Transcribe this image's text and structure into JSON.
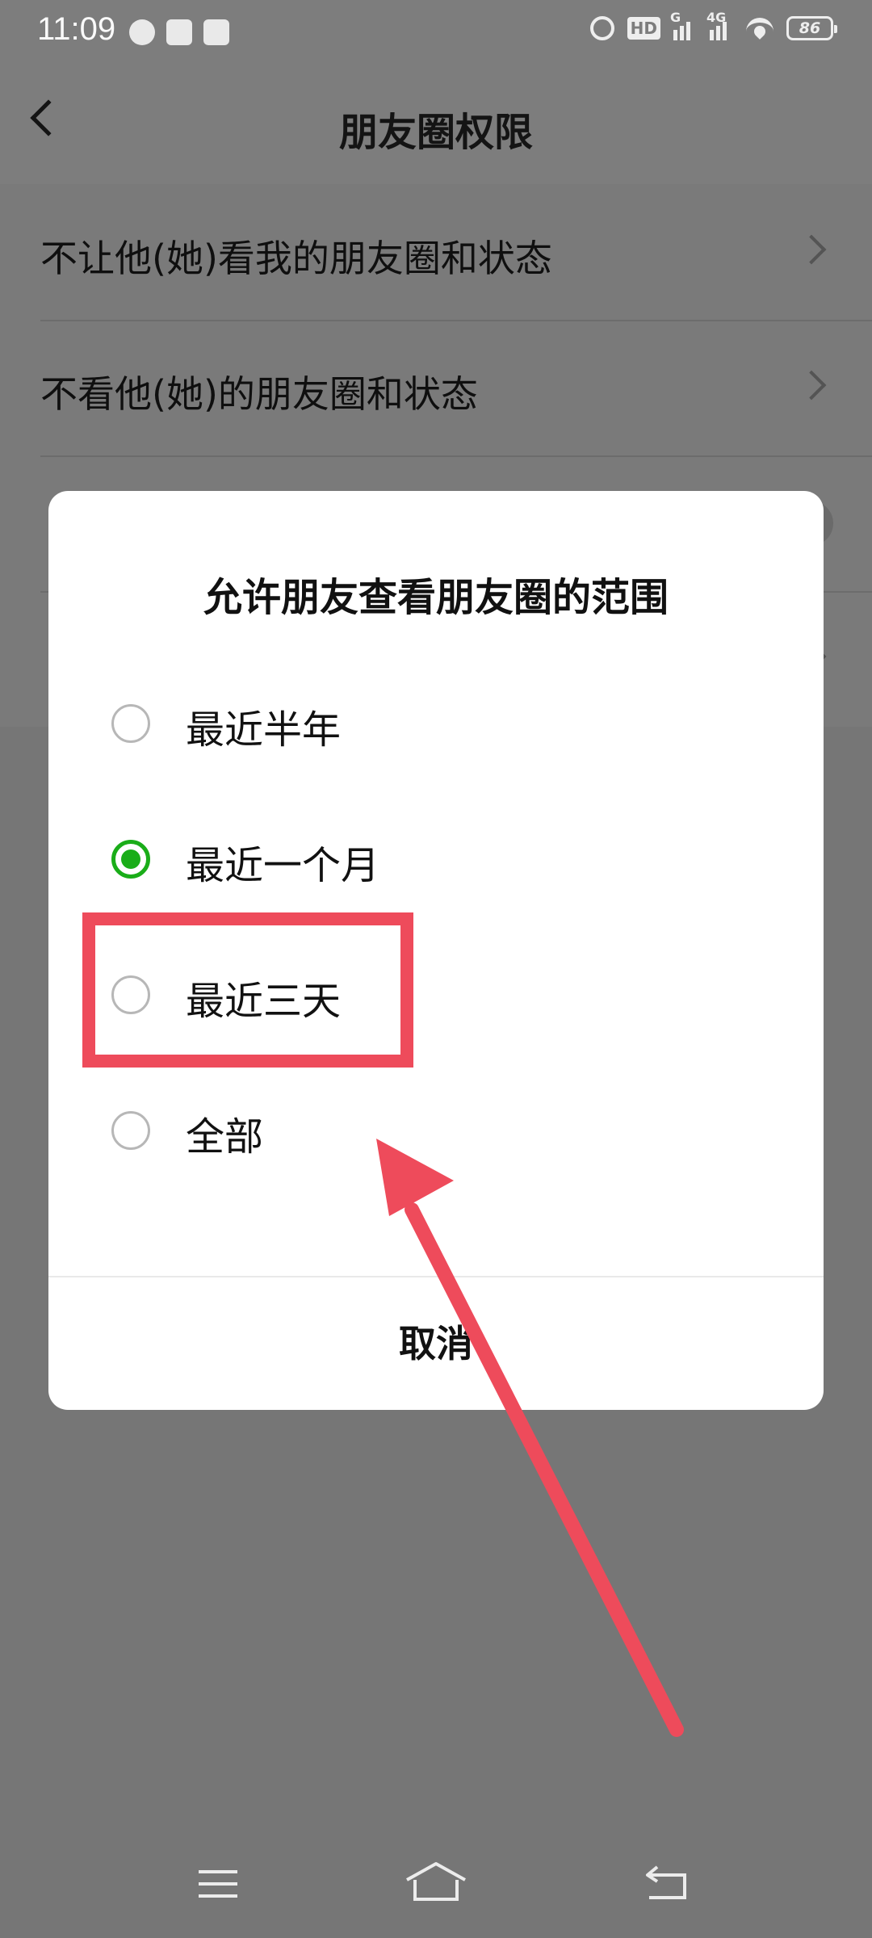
{
  "status_bar": {
    "time": "11:09",
    "network_label": "4G",
    "signal_label": "G",
    "hd_label": "HD",
    "battery_level": "86",
    "icons": [
      "speedometer-icon",
      "app-notification-icon",
      "lock-app-icon",
      "alarm-icon",
      "hd-voice-icon",
      "signal-icon",
      "wifi-icon",
      "battery-icon"
    ]
  },
  "header": {
    "title": "朋友圈权限",
    "back_icon": "chevron-left-icon"
  },
  "settings": {
    "items": [
      {
        "label": "不让他(她)看我的朋友圈和状态",
        "control": "chevron-right-icon"
      },
      {
        "label": "不看他(她)的朋友圈和状态",
        "control": "chevron-right-icon"
      },
      {
        "label": "",
        "control": "toggle-switch"
      },
      {
        "label": "",
        "control": "chevron-right-icon"
      }
    ]
  },
  "dialog": {
    "title": "允许朋友查看朋友圈的范围",
    "options": [
      {
        "label": "最近半年",
        "selected": false
      },
      {
        "label": "最近一个月",
        "selected": true
      },
      {
        "label": "最近三天",
        "selected": false
      },
      {
        "label": "全部",
        "selected": false
      }
    ],
    "cancel_label": "取消"
  },
  "annotation": {
    "highlighted_option": "最近三天",
    "color": "#ee4b5b"
  },
  "colors": {
    "accent_green": "#1aad19",
    "overlay_gray": "#767676",
    "annotation_red": "#ee4b5b"
  },
  "system_nav": {
    "icons": [
      "menu-icon",
      "home-icon",
      "back-icon"
    ]
  }
}
